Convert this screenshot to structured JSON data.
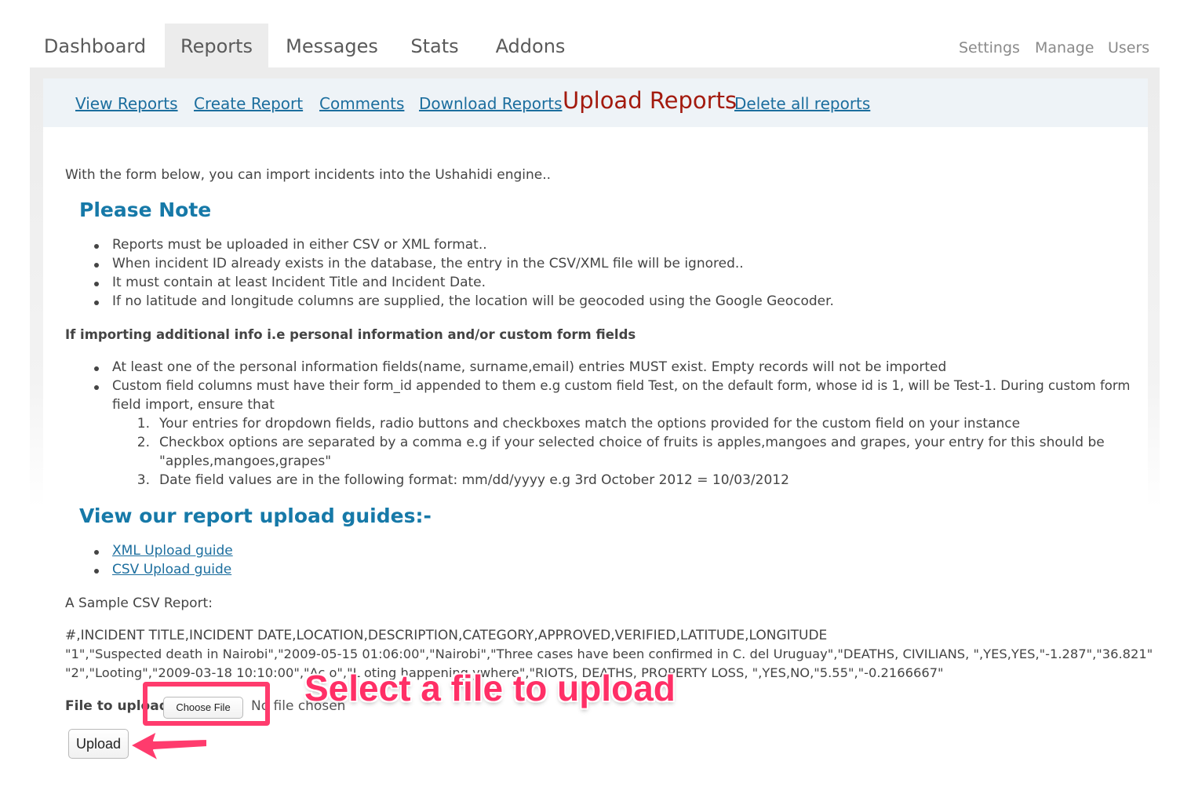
{
  "top_tabs": [
    "Dashboard",
    "Reports",
    "Messages",
    "Stats",
    "Addons"
  ],
  "right_nav": [
    "Settings",
    "Manage",
    "Users"
  ],
  "subnav": {
    "view_reports": "View Reports",
    "create_report": "Create Report",
    "comments": "Comments",
    "download_reports": "Download Reports",
    "upload_reports": "Upload Reports",
    "delete_all": "Delete all reports"
  },
  "intro": "With the form below, you can import incidents into the Ushahidi engine..",
  "please_note": {
    "heading": "Please Note",
    "items": [
      "Reports must be uploaded in either CSV or XML format..",
      "When incident ID already exists in the database, the entry in the CSV/XML file will be ignored..",
      "It must contain at least Incident Title and Incident Date.",
      "If no latitude and longitude columns are supplied, the location will be geocoded using the Google Geocoder."
    ]
  },
  "additional": {
    "heading": "If importing additional info i.e personal information and/or custom form fields",
    "item1": "At least one of the personal information fields(name, surname,email) entries MUST exist. Empty records will not be imported",
    "item2_line1": "Custom field columns must have their form_id appended to them e.g custom field Test, on the default form, whose id is 1, will be Test-1. During custom form",
    "item2_line2": "field import, ensure that",
    "sub1": "Your entries for dropdown fields, radio buttons and checkboxes match the options provided for the custom field on your instance",
    "sub2_line1": "Checkbox options are separated by a comma e.g if your selected choice of fruits is apples,mangoes and grapes, your entry for this should be",
    "sub2_line2": "\"apples,mangoes,grapes\"",
    "sub3": "Date field values are in the following format: mm/dd/yyyy e.g 3rd October 2012 = 10/03/2012"
  },
  "guides": {
    "heading": "View our report upload guides:-",
    "xml": "XML Upload guide",
    "csv": "CSV Upload guide"
  },
  "sample": {
    "label": "A Sample CSV Report:",
    "line1": "#,INCIDENT TITLE,INCIDENT DATE,LOCATION,DESCRIPTION,CATEGORY,APPROVED,VERIFIED,LATITUDE,LONGITUDE",
    "line2": "\"1\",\"Suspected death in Nairobi\",\"2009-05-15 01:06:00\",\"Nairobi\",\"Three cases have been confirmed in C. del Uruguay\",\"DEATHS, CIVILIANS, \",YES,YES,\"-1.287\",\"36.821\"",
    "line3": "\"2\",\"Looting\",\"2009-03-18 10:10:00\",\"Ac  o\",\"L  oting happening    ywhere\",\"RIOTS, DEATHS, PROPERTY LOSS, \",YES,NO,\"5.55\",\"-0.2166667\""
  },
  "form": {
    "file_label": "File to upload",
    "choose_file": "Choose File",
    "no_file": "No file chosen",
    "upload": "Upload"
  },
  "annotation": {
    "text": "Select a file to upload",
    "color": "#ff2f66"
  }
}
